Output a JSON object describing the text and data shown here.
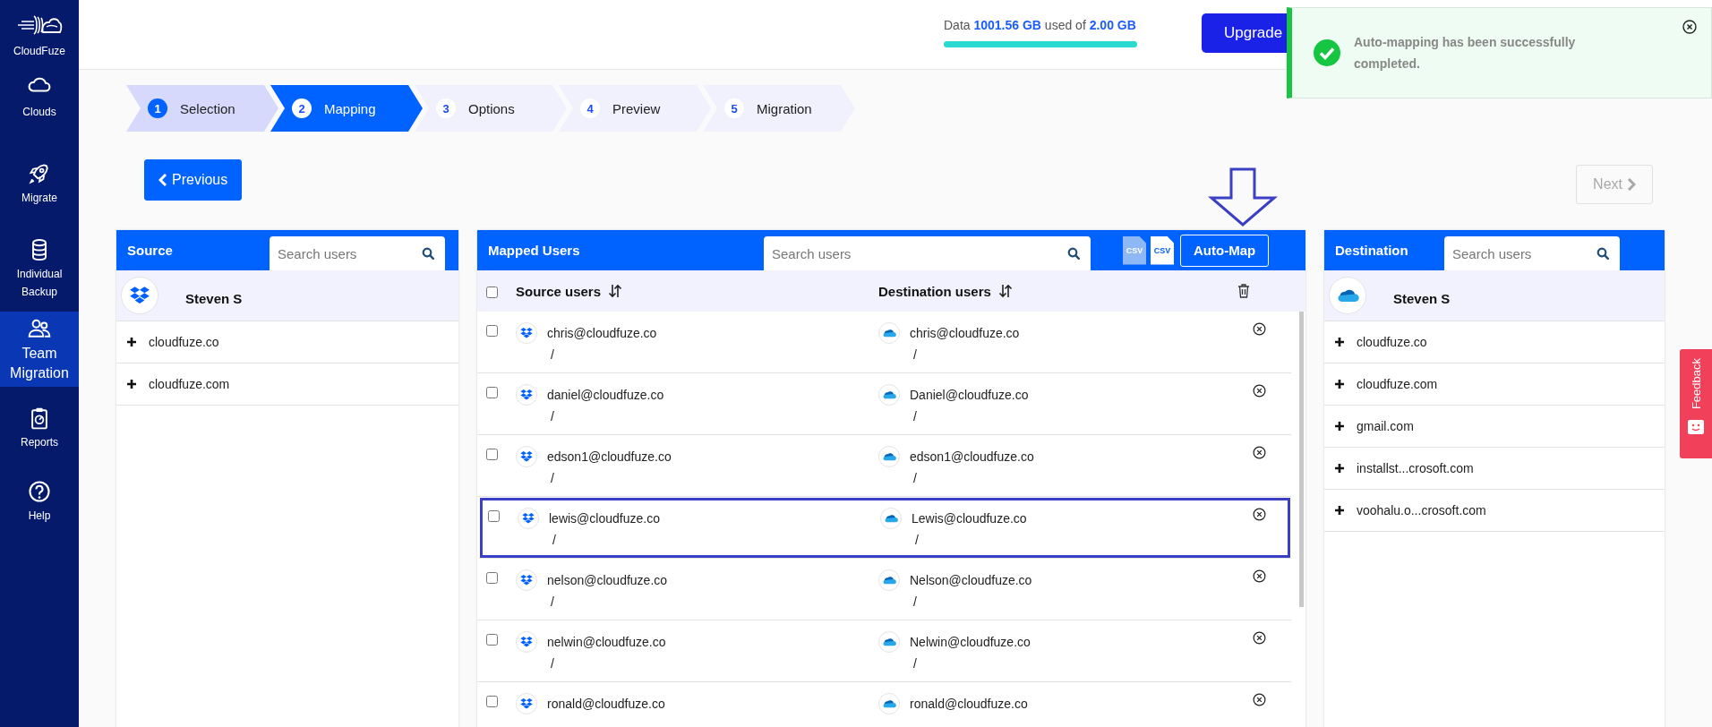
{
  "sidebar": {
    "logo": "CloudFuze",
    "items": [
      {
        "label": "Clouds",
        "selected": false
      },
      {
        "label": "Migrate",
        "selected": false
      },
      {
        "label": "Individual Backup",
        "selected": false
      },
      {
        "label": "Team Migration",
        "selected": true
      },
      {
        "label": "Reports",
        "selected": false
      },
      {
        "label": "Help",
        "selected": false
      }
    ]
  },
  "header": {
    "usage": {
      "text": "Data **1001.56 GB** used of **2.00 GB**",
      "level": 1
    },
    "upgrade_button": "Upgrade"
  },
  "toast": {
    "message": "Auto-mapping has been successfully completed."
  },
  "steps": [
    {
      "number": "1",
      "label": "Selection",
      "completed": true,
      "selected": false
    },
    {
      "number": "2",
      "label": "Mapping",
      "completed": false,
      "selected": true
    },
    {
      "number": "3",
      "label": "Options",
      "completed": false,
      "selected": false
    },
    {
      "number": "4",
      "label": "Preview",
      "completed": false,
      "selected": false
    },
    {
      "number": "5",
      "label": "Migration",
      "completed": false,
      "selected": false
    }
  ],
  "navigation": {
    "previous": {
      "label": "Previous",
      "disabled": false
    },
    "next": {
      "label": "Next",
      "disabled": true
    }
  },
  "source": {
    "title": "Source",
    "search": {
      "placeholder": "Search users"
    },
    "account": {
      "name": "Steven S"
    },
    "domains": [
      "cloudfuze.co",
      "cloudfuze.com"
    ]
  },
  "mapped": {
    "title": "Mapped Users",
    "search": {
      "placeholder": "Search users"
    },
    "csv_buttons": [
      {
        "label": "CSV",
        "kind": "download"
      },
      {
        "label": "CSV",
        "kind": "upload"
      }
    ],
    "auto_map_button": "Auto-Map",
    "all_checked": false,
    "columns": [
      "Source users",
      "Destination users"
    ],
    "rows": [
      {
        "checked": false,
        "highlighted": false,
        "source": "chris@cloudfuze.co",
        "source_path": "/",
        "destination": "chris@cloudfuze.co",
        "destination_path": "/"
      },
      {
        "checked": false,
        "highlighted": false,
        "source": "daniel@cloudfuze.co",
        "source_path": "/",
        "destination": "Daniel@cloudfuze.co",
        "destination_path": "/"
      },
      {
        "checked": false,
        "highlighted": false,
        "source": "edson1@cloudfuze.co",
        "source_path": "/",
        "destination": "edson1@cloudfuze.co",
        "destination_path": "/"
      },
      {
        "checked": false,
        "highlighted": true,
        "source": "lewis@cloudfuze.co",
        "source_path": "/",
        "destination": "Lewis@cloudfuze.co",
        "destination_path": "/"
      },
      {
        "checked": false,
        "highlighted": false,
        "source": "nelson@cloudfuze.co",
        "source_path": "/",
        "destination": "Nelson@cloudfuze.co",
        "destination_path": "/"
      },
      {
        "checked": false,
        "highlighted": false,
        "source": "nelwin@cloudfuze.co",
        "source_path": "/",
        "destination": "Nelwin@cloudfuze.co",
        "destination_path": "/"
      },
      {
        "checked": false,
        "highlighted": false,
        "source": "ronald@cloudfuze.co",
        "destination": "ronald@cloudfuze.co"
      }
    ]
  },
  "destination": {
    "title": "Destination",
    "search": {
      "placeholder": "Search users"
    },
    "account": {
      "name": "Steven S"
    },
    "domains": [
      "cloudfuze.co",
      "cloudfuze.com",
      "gmail.com",
      "installst...crosoft.com",
      "voohalu.o...crosoft.com"
    ]
  },
  "feedback": {
    "label": "Feedback"
  }
}
